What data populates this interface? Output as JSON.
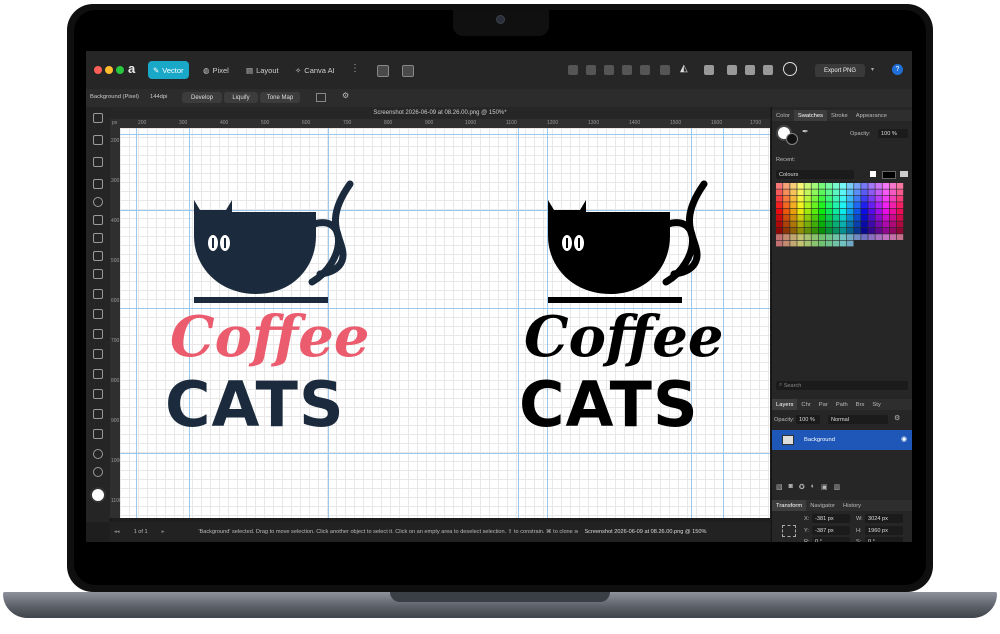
{
  "toolbar": {
    "personas": [
      {
        "label": "Vector",
        "active": true
      },
      {
        "label": "Pixel",
        "active": false
      },
      {
        "label": "Layout",
        "active": false
      },
      {
        "label": "Canva AI",
        "active": false
      }
    ],
    "export_label": "Export PNG",
    "help_label": "?"
  },
  "context": {
    "layer_info": "Background (Pixel)",
    "dpi": "144dpi",
    "buttons": [
      "Develop",
      "Liquify",
      "Tone Map"
    ]
  },
  "document": {
    "title": "Screenshot 2026-06-09 at 08.26.00.png @ 150%*",
    "ruler_unit": "px",
    "hticks": [
      "200",
      "300",
      "400",
      "500",
      "600",
      "700",
      "800",
      "900",
      "1000",
      "1100",
      "1200",
      "1300",
      "1400",
      "1500",
      "1600",
      "1700"
    ],
    "vticks": [
      "200",
      "300",
      "400",
      "500",
      "600",
      "700",
      "800",
      "900",
      "1000",
      "1100"
    ]
  },
  "artwork": {
    "left": {
      "script": "Coffee",
      "block": "CATS",
      "script_color": "#ea5c6e",
      "block_color": "#1b2b3d"
    },
    "right": {
      "script": "Coffee",
      "block": "CATS",
      "script_color": "#000000",
      "block_color": "#000000"
    }
  },
  "status": {
    "page": "1 of 1",
    "message": "'Background' selected. Drag to move selection. Click another object to select it. Click on an empty area to deselect selection. ⇧ to constrain. ⌘ to clone selected objects. ⌥ to ignore snapping",
    "doc_name": "Screenshot 2026-06-09 at 08.26.00.png @ 150%"
  },
  "panels": {
    "color_tabs": [
      "Color",
      "Swatches",
      "Stroke",
      "Appearance"
    ],
    "opacity_label": "Opacity:",
    "opacity_value": "100 %",
    "recent_label": "Recent:",
    "palette": "Colours",
    "search_placeholder": "Search",
    "layer_tabs": [
      "Layers",
      "Chr",
      "Par",
      "Path",
      "Brs",
      "Sty"
    ],
    "layer_opacity_label": "Opacity:",
    "layer_opacity": "100 %",
    "blend_mode": "Normal",
    "layer_name": "Background",
    "transform_tabs": [
      "Transform",
      "Navigator",
      "History"
    ],
    "transform": {
      "x_label": "X:",
      "x": "-381 px",
      "y_label": "Y:",
      "y": "-387 px",
      "w_label": "W:",
      "w": "3024 px",
      "h_label": "H:",
      "h": "1960 px",
      "r_label": "R:",
      "r": "0 °",
      "s_label": "S:",
      "s": "0 °"
    }
  }
}
